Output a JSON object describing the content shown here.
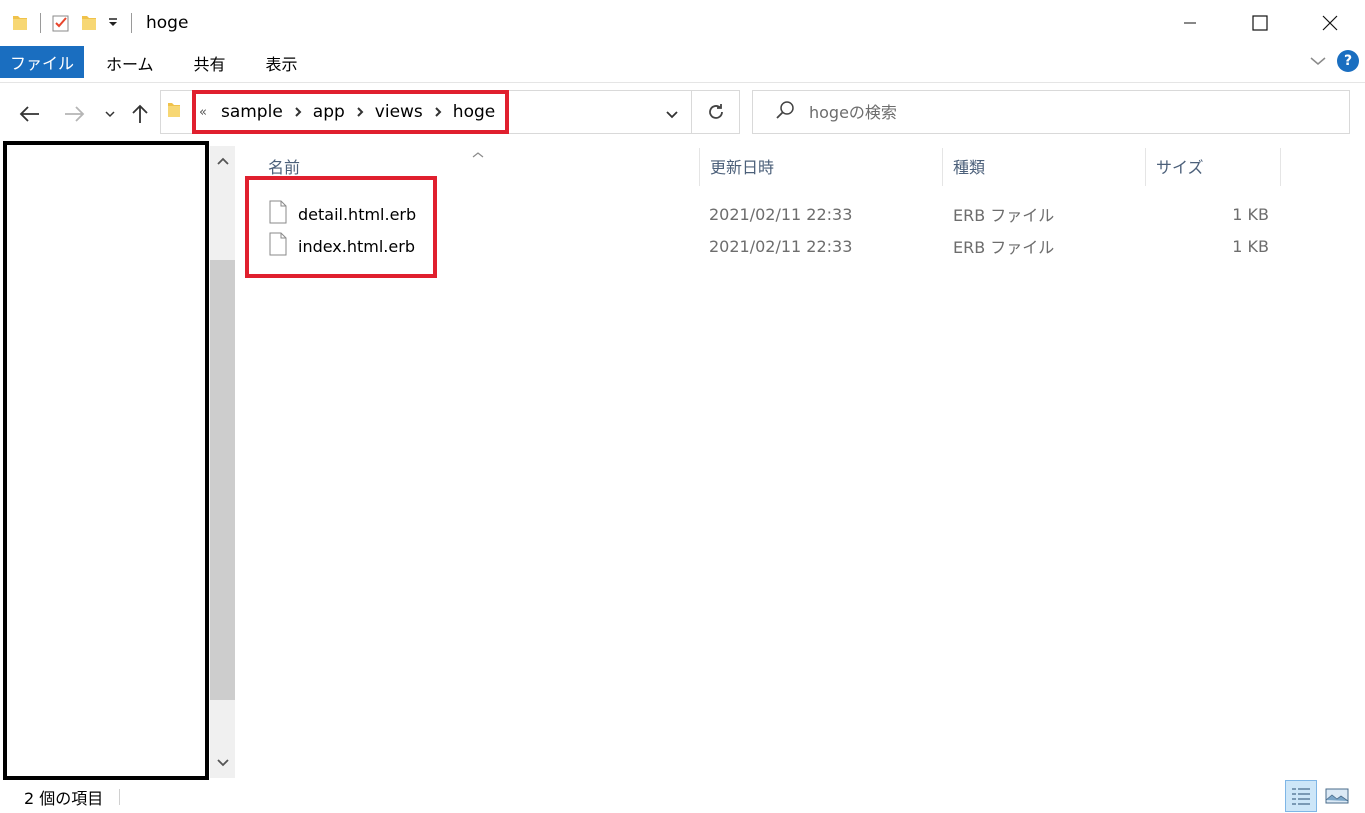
{
  "window": {
    "title": "hoge"
  },
  "ribbon": {
    "tabs": [
      "ファイル",
      "ホーム",
      "共有",
      "表示"
    ],
    "help_label": "?"
  },
  "address": {
    "overflow": "«",
    "crumbs": [
      "sample",
      "app",
      "views",
      "hoge"
    ]
  },
  "search": {
    "placeholder": "hogeの検索"
  },
  "columns": {
    "name": "名前",
    "modified": "更新日時",
    "type": "種類",
    "size": "サイズ"
  },
  "files": [
    {
      "name": "detail.html.erb",
      "modified": "2021/02/11 22:33",
      "type": "ERB ファイル",
      "size": "1 KB"
    },
    {
      "name": "index.html.erb",
      "modified": "2021/02/11 22:33",
      "type": "ERB ファイル",
      "size": "1 KB"
    }
  ],
  "status": {
    "item_count": "2 個の項目"
  },
  "colors": {
    "accent": "#1a6ec0",
    "highlight": "#e0202e",
    "folder": "#f0c24a"
  }
}
